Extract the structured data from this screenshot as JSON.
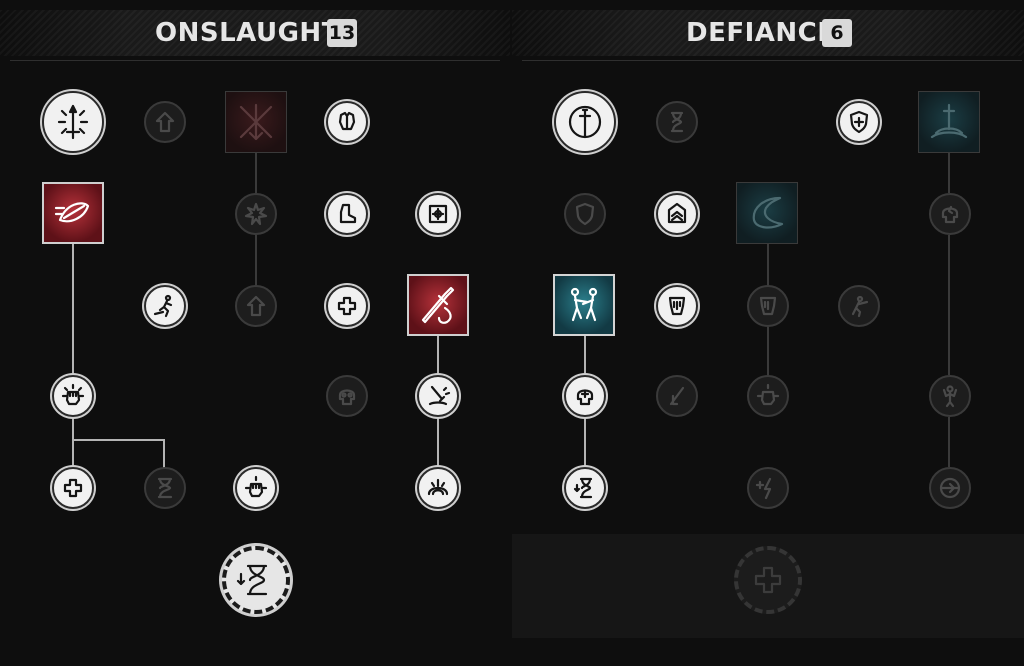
{
  "trees": {
    "onslaught": {
      "title": "ONSLAUGHT",
      "points": "13"
    },
    "defiance": {
      "title": "DEFIANCE",
      "points": "6"
    }
  },
  "colors": {
    "background": "#0e0e0e",
    "skill_active": "#f1f1f1",
    "skill_inactive": "#1d1d1d",
    "onslaught_accent": "#b6323a",
    "defiance_accent": "#2b7f8c",
    "badge": "#d9d9d9"
  }
}
